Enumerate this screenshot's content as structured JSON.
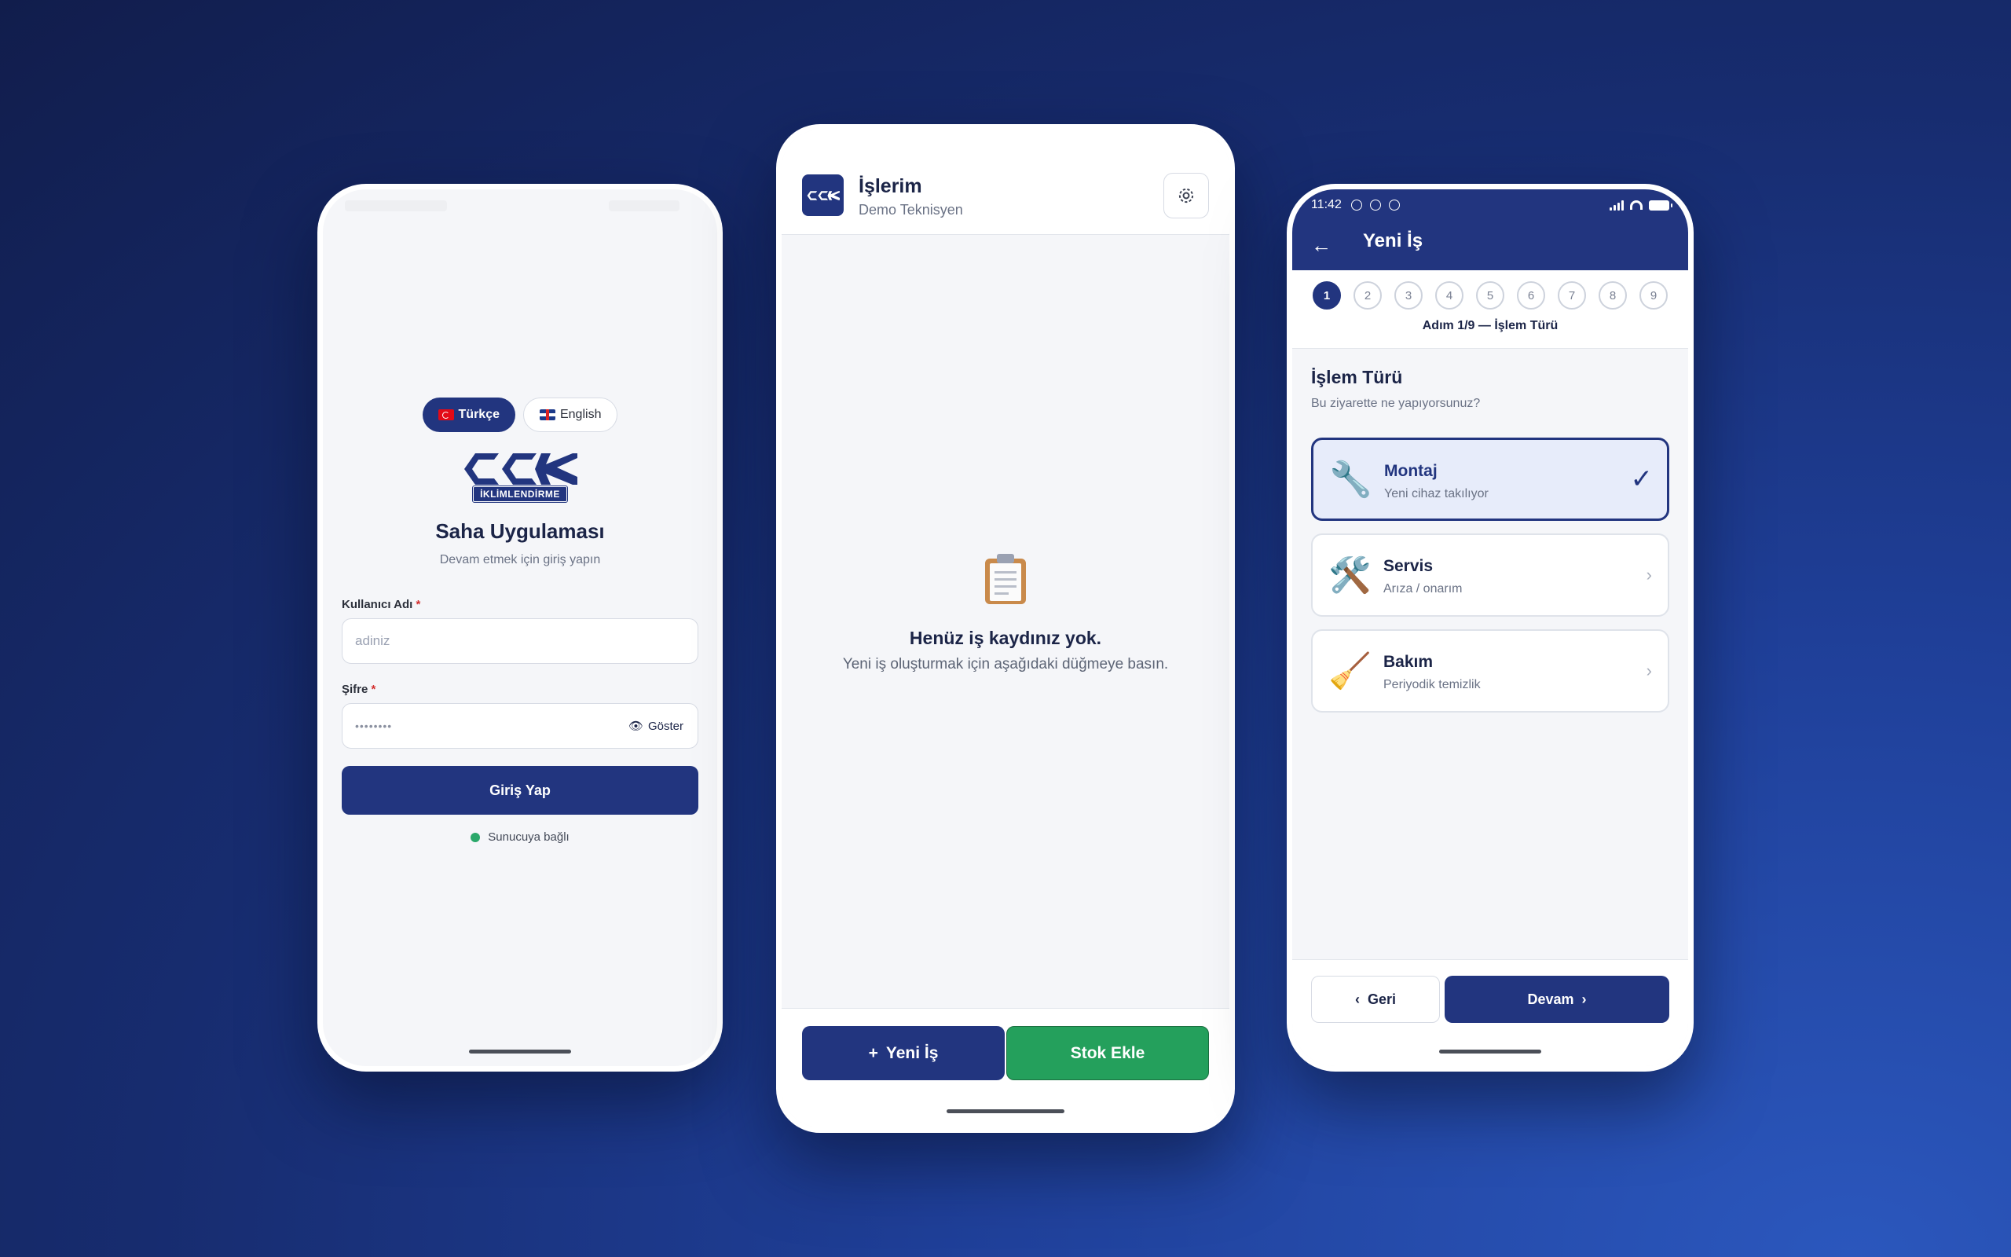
{
  "login": {
    "languages": [
      {
        "label": "Türkçe",
        "flag": "turkey-flag",
        "active": true
      },
      {
        "label": "English",
        "flag": "uk-flag",
        "active": false
      }
    ],
    "logo_text": "İKLİMLENDİRME",
    "app_title": "Saha Uygulaması",
    "app_subtitle": "Devam etmek için giriş yapın",
    "username_label": "Kullanıcı Adı",
    "username_placeholder": "adiniz",
    "password_label": "Şifre",
    "password_masked": "••••••••",
    "required_mark": "*",
    "show_label": "Göster",
    "login_button": "Giriş Yap",
    "connection_status": "Sunucuya bağlı",
    "connection_color": "#2aa86a"
  },
  "jobs": {
    "title": "İşlerim",
    "subtitle": "Demo Teknisyen",
    "empty_icon": "clipboard-icon",
    "empty_title": "Henüz iş kaydınız yok.",
    "empty_subtitle": "Yeni iş oluşturmak için aşağıdaki düğmeye basın.",
    "new_job_button": "Yeni İş",
    "new_job_prefix": "+",
    "add_stock_button": "Stok Ekle"
  },
  "wizard": {
    "status_time": "11:42",
    "title": "Yeni İş",
    "steps": [
      "1",
      "2",
      "3",
      "4",
      "5",
      "6",
      "7",
      "8",
      "9"
    ],
    "active_step": 1,
    "step_label": "Adım 1/9 — İşlem Türü",
    "section_title": "İşlem Türü",
    "section_subtitle": "Bu ziyarette ne yapıyorsunuz?",
    "options": [
      {
        "name": "Montaj",
        "desc": "Yeni cihaz takılıyor",
        "icon": "🔧",
        "selected": true
      },
      {
        "name": "Servis",
        "desc": "Arıza / onarım",
        "icon": "🛠️",
        "selected": false
      },
      {
        "name": "Bakım",
        "desc": "Periyodik temizlik",
        "icon": "🧹",
        "selected": false
      }
    ],
    "back_button": "Geri",
    "next_button": "Devam",
    "back_chevron": "‹",
    "next_chevron": "›"
  },
  "colors": {
    "brand": "#22357f",
    "success": "#24a05c",
    "background": "#1f3f98"
  }
}
